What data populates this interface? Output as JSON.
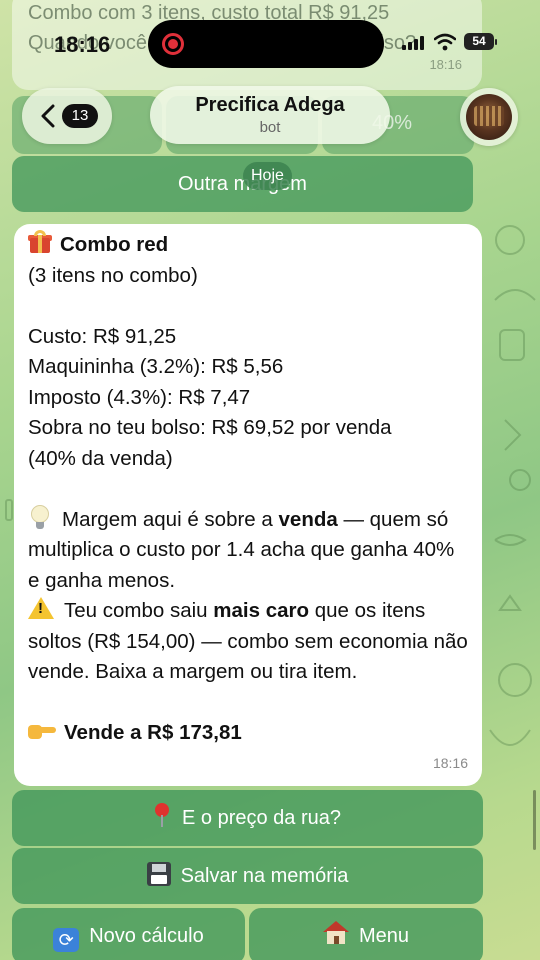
{
  "ghost": {
    "message_text": "Combo com 3 itens, custo total R$ 91,25 Quando você vende, o que sobra no bolso?",
    "message_time": "18:16",
    "percent_label": "40%"
  },
  "status_bar": {
    "time": "18:16",
    "battery": "54"
  },
  "header": {
    "back_count": "13",
    "title": "Precifica Adega",
    "subtitle": "bot"
  },
  "top_button": {
    "label": "Outra margem"
  },
  "date_chip": "Hoje",
  "message": {
    "title": "Combo red",
    "subtitle": "(3 itens no combo)",
    "lines": [
      "Custo: R$ 91,25",
      "Maquininha (3.2%): R$ 5,56",
      "Imposto (4.3%): R$ 7,47",
      "Sobra no teu bolso: R$ 69,52 por venda",
      "(40% da venda)"
    ],
    "tip": {
      "pre": "Margem aqui é sobre a ",
      "bold": "venda",
      "post": " — quem só multiplica o custo por 1.4 acha que ganha 40% e ganha menos."
    },
    "warning": {
      "pre": "Teu combo saiu ",
      "bold": "mais caro",
      "post": " que os itens soltos (R$ 154,00) — combo sem economia não vende. Baixa a margem ou tira item."
    },
    "final": "Vende a R$ 173,81",
    "time": "18:16"
  },
  "keyboard": {
    "street_price": "E o preço da rua?",
    "save_memory": "Salvar na memória",
    "new_calc": "Novo cálculo",
    "menu": "Menu"
  },
  "colors": {
    "button_green": "#40965a",
    "bubble": "#ffffff"
  }
}
